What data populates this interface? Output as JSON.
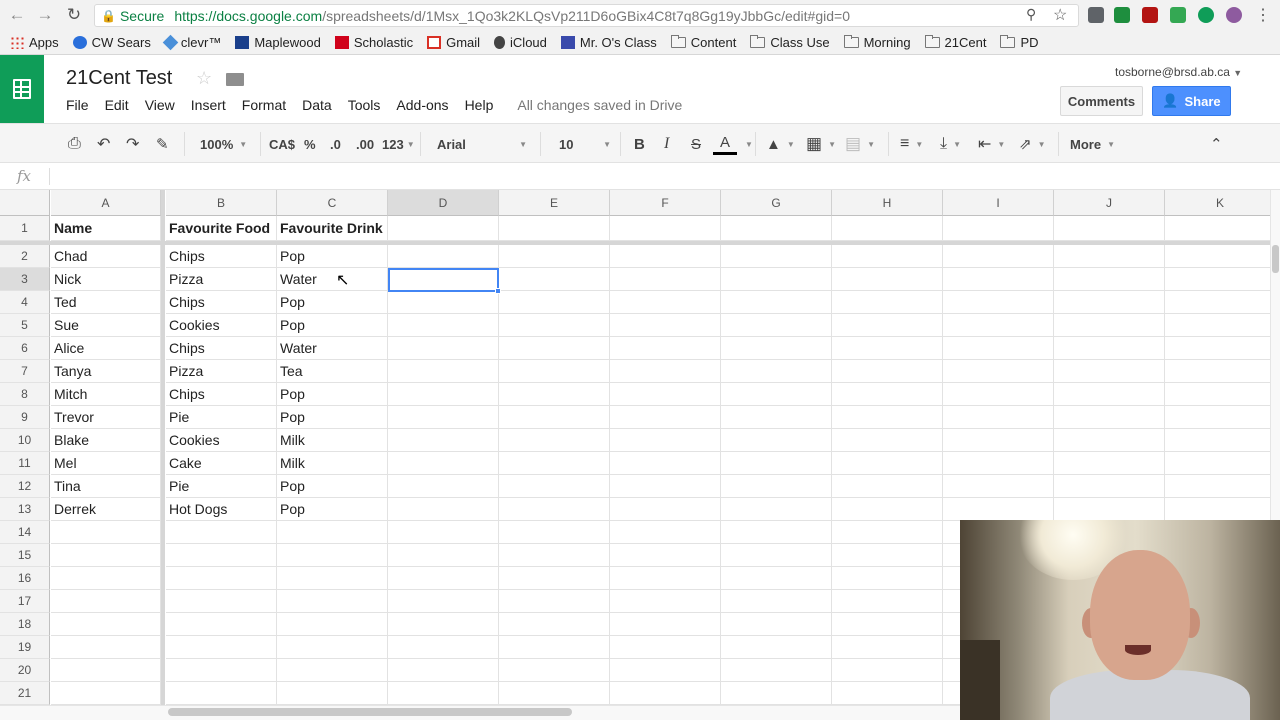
{
  "browser": {
    "secure_label": "Secure",
    "url_base": "https://docs.google.com",
    "url_rest": "/spreadsheets/d/1Msx_1Qo3k2KLQsVp211D6oGBix4C8t7q8Gg19yJbbGc/edit#gid=0"
  },
  "bookmarks": [
    "Apps",
    "CW Sears",
    "clevr™",
    "Maplewood",
    "Scholastic",
    "Gmail",
    "iCloud",
    "Mr. O's Class",
    "Content",
    "Class Use",
    "Morning",
    "21Cent",
    "PD"
  ],
  "doc": {
    "title": "21Cent Test",
    "status": "All changes saved in Drive",
    "user_email": "tosborne@brsd.ab.ca",
    "comments_label": "Comments",
    "share_label": "Share"
  },
  "menu": [
    "File",
    "Edit",
    "View",
    "Insert",
    "Format",
    "Data",
    "Tools",
    "Add-ons",
    "Help"
  ],
  "toolbar": {
    "zoom": "100%",
    "currency": "CA$",
    "percent": "%",
    "dec_less": ".0",
    "dec_more": ".00",
    "format_more": "123",
    "font": "Arial",
    "font_size": "10",
    "bold": "B",
    "italic": "I",
    "strike": "S",
    "text_color": "A",
    "more": "More"
  },
  "formula_bar": {
    "fx": "fx",
    "value": ""
  },
  "columns": [
    "A",
    "B",
    "C",
    "D",
    "E",
    "F",
    "G",
    "H",
    "I",
    "J",
    "K"
  ],
  "rows": [
    [
      "Name",
      "Favourite Food",
      "Favourite Drink"
    ],
    [
      "Chad",
      "Chips",
      "Pop"
    ],
    [
      "Nick",
      "Pizza",
      "Water"
    ],
    [
      "Ted",
      "Chips",
      "Pop"
    ],
    [
      "Sue",
      "Cookies",
      "Pop"
    ],
    [
      "Alice",
      "Chips",
      "Water"
    ],
    [
      "Tanya",
      "Pizza",
      "Tea"
    ],
    [
      "Mitch",
      "Chips",
      "Pop"
    ],
    [
      "Trevor",
      "Pie",
      "Pop"
    ],
    [
      "Blake",
      "Cookies",
      "Milk"
    ],
    [
      "Mel",
      "Cake",
      "Milk"
    ],
    [
      "Tina",
      "Pie",
      "Pop"
    ],
    [
      "Derrek",
      "Hot Dogs",
      "Pop"
    ]
  ],
  "row_numbers": [
    "1",
    "2",
    "3",
    "4",
    "5",
    "6",
    "7",
    "8",
    "9",
    "10",
    "11",
    "12",
    "13",
    "14",
    "15",
    "16",
    "17",
    "18",
    "19",
    "20",
    "21"
  ],
  "selected_cell": "D3",
  "colors": {
    "sheets_green": "#0f9d58",
    "share_blue": "#4d90fe",
    "selection": "#4285f4"
  }
}
